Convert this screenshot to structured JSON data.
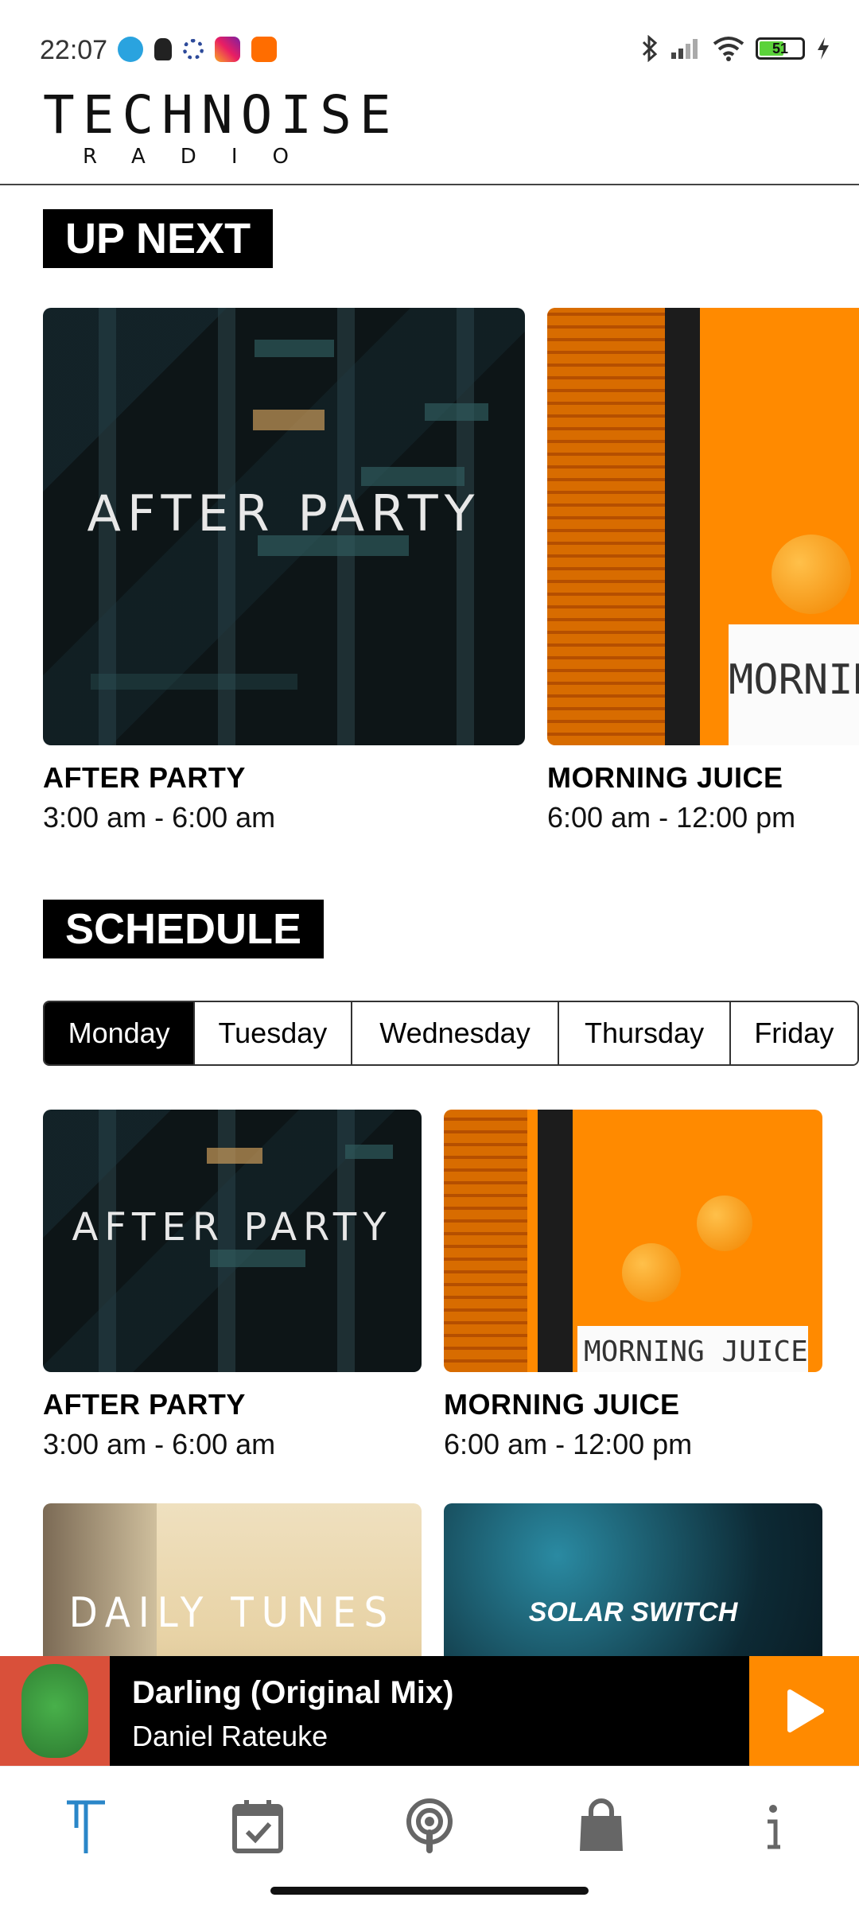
{
  "status_bar": {
    "time": "22:07",
    "battery": "51",
    "left_icons": [
      "telegram-icon",
      "app-icon",
      "settings-icon",
      "instagram-icon",
      "mi-icon"
    ],
    "right_icons": [
      "bluetooth-icon",
      "signal-icon",
      "wifi-icon",
      "battery-icon",
      "charging-icon"
    ]
  },
  "header": {
    "logo_main": "TECHNOISE",
    "logo_sub": "RADIO"
  },
  "up_next": {
    "heading": "UP NEXT",
    "items": [
      {
        "title": "AFTER PARTY",
        "time": "3:00 am - 6:00 am",
        "art_text": "AFTER PARTY"
      },
      {
        "title": "MORNING JUICE",
        "time": "6:00 am - 12:00 pm",
        "art_text": "MORNINC"
      }
    ]
  },
  "schedule": {
    "heading": "SCHEDULE",
    "days": [
      "Monday",
      "Tuesday",
      "Wednesday",
      "Thursday",
      "Friday"
    ],
    "active_day": "Monday",
    "items": [
      {
        "title": "AFTER PARTY",
        "time": "3:00 am - 6:00 am",
        "art_text": "AFTER PARTY"
      },
      {
        "title": "MORNING JUICE",
        "time": "6:00 am - 12:00 pm",
        "art_text": "MORNING JUICE"
      },
      {
        "title": "",
        "time": "",
        "art_text": "DAILY TUNES"
      },
      {
        "title": "",
        "time": "",
        "art_text": "SOLAR SWITCH"
      }
    ]
  },
  "now_playing": {
    "track": "Darling (Original Mix)",
    "artist": "Daniel Rateuke"
  },
  "nav": {
    "items": [
      "home-logo-icon",
      "calendar-icon",
      "podcast-icon",
      "shop-bag-icon",
      "info-icon"
    ],
    "active_color": "#2a86c8",
    "inactive_color": "#666666"
  },
  "colors": {
    "accent": "#ff8a00",
    "player_bg": "#000000",
    "mini_art_bg": "#d9503a"
  }
}
